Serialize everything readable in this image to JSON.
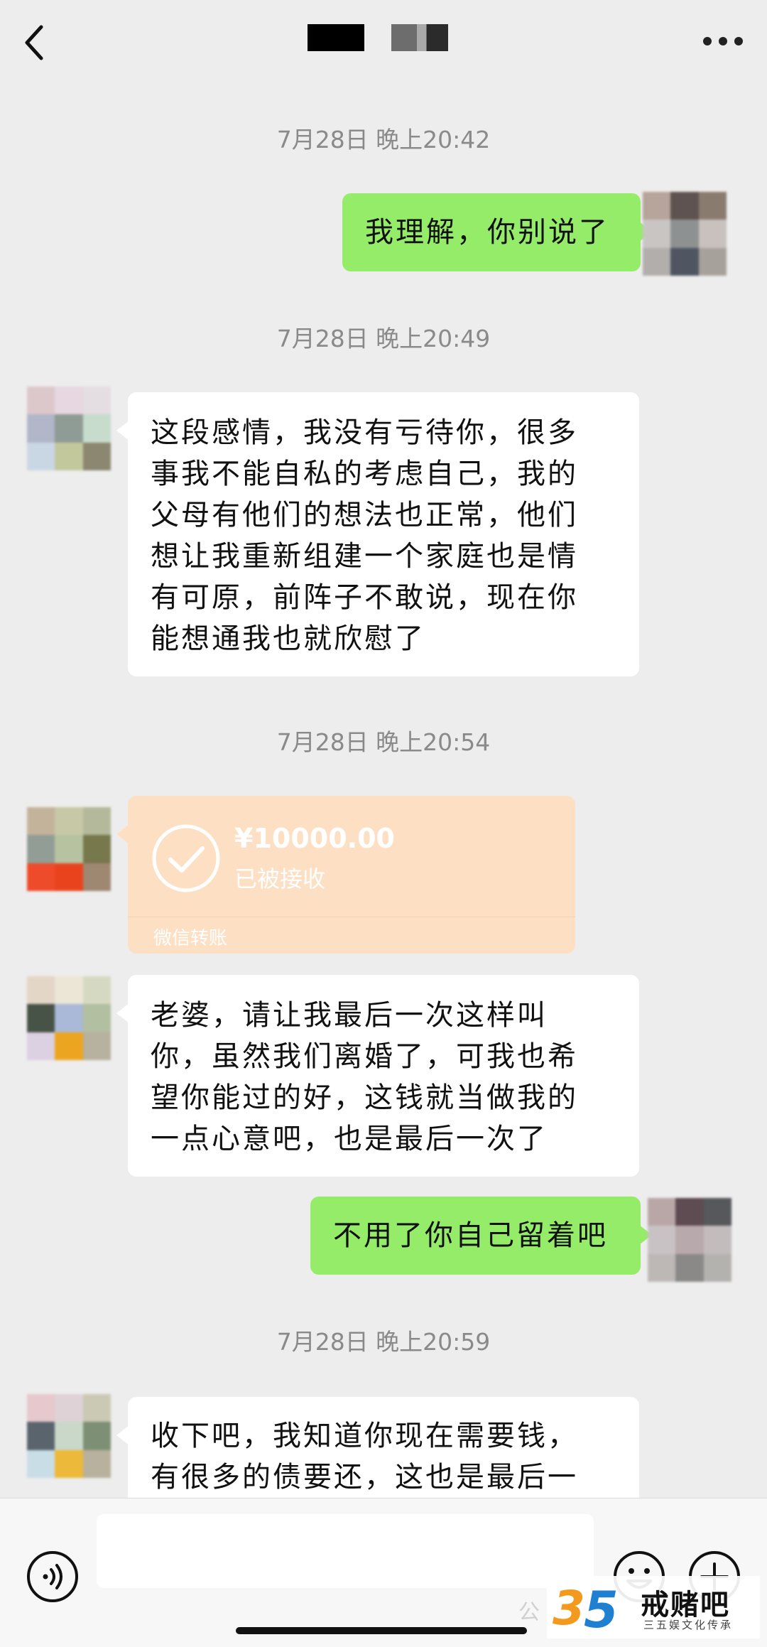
{
  "header": {
    "back_icon": "chevron-left-icon",
    "more_icon": "ellipsis-icon"
  },
  "messages": {
    "ts1": "7月28日 晚上20:42",
    "m1_lines": [
      "我理解，你别说了"
    ],
    "ts2": "7月28日 晚上20:49",
    "m2_lines": [
      "这段感情，我没有亏待你，很多",
      "事我不能自私的考虑自己，我的",
      "父母有他们的想法也正常，他们",
      "想让我重新组建一个家庭也是情",
      "有可原，前阵子不敢说，现在你",
      "能想通我也就欣慰了"
    ],
    "ts3": "7月28日 晚上20:54",
    "transfer": {
      "amount": "¥10000.00",
      "status": "已被接收",
      "footer": "微信转账"
    },
    "m4_lines": [
      "老婆，请让我最后一次这样叫",
      "你，虽然我们离婚了，可我也希",
      "望你能过的好，这钱就当做我的",
      "一点心意吧，也是最后一次了"
    ],
    "m5_lines": [
      "不用了你自己留着吧"
    ],
    "ts4": "7月28日 晚上20:59",
    "m6_lines": [
      "收下吧，我知道你现在需要钱，",
      "有很多的债要还，这也是最后一"
    ]
  },
  "input_bar": {
    "voice_icon": "voice-icon",
    "emoji_icon": "emoji-icon",
    "plus_icon": "plus-icon",
    "text_value": ""
  },
  "watermark": {
    "logo_text": "35",
    "title": "戒赌吧",
    "subtitle": "三五娱文化传承",
    "faint": "公"
  },
  "colors": {
    "sent_bubble": "#95ec69",
    "received_bubble": "#ffffff",
    "transfer_bubble": "#fde0c4",
    "background": "#ededed"
  }
}
